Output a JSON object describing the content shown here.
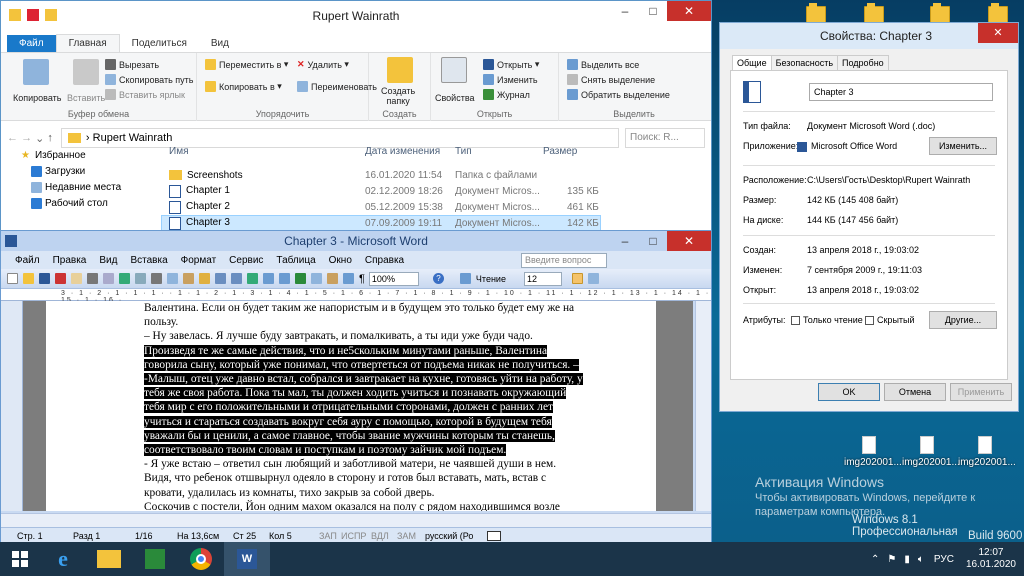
{
  "desktop": {
    "icons": [
      {
        "label": "img202001..."
      },
      {
        "label": "img202001..."
      },
      {
        "label": "img202001..."
      }
    ],
    "activation": {
      "title": "Активация Windows",
      "line1": "Чтобы активировать Windows, перейдите к",
      "line2": "параметрам компьютера.",
      "edition": "Windows 8.1 Профессиональная",
      "build": "Build 9600"
    }
  },
  "explorer": {
    "title": "Rupert Wainrath",
    "tabs": [
      "Файл",
      "Главная",
      "Поделиться",
      "Вид"
    ],
    "ribbon": {
      "copy": "Копировать",
      "paste": "Вставить",
      "cut": "Вырезать",
      "copy_path": "Скопировать путь",
      "paste_shortcut": "Вставить ярлык",
      "clipboard": "Буфер обмена",
      "move_to": "Переместить в",
      "copy_to": "Копировать в",
      "delete": "Удалить",
      "rename": "Переименовать",
      "organize": "Упорядочить",
      "new_folder_1": "Создать",
      "new_folder_2": "папку",
      "create": "Создать",
      "properties": "Свойства",
      "open": "Открыть",
      "edit": "Изменить",
      "history": "Журнал",
      "open_group": "Открыть",
      "select_all": "Выделить все",
      "select_none": "Снять выделение",
      "invert": "Обратить выделение",
      "select": "Выделить"
    },
    "address": "Rupert Wainrath",
    "search_placeholder": "Поиск: R...",
    "nav": [
      "Избранное",
      "Загрузки",
      "Недавние места",
      "Рабочий стол"
    ],
    "columns": [
      "Имя",
      "Дата изменения",
      "Тип",
      "Размер"
    ],
    "rows": [
      {
        "name": "Screenshots",
        "date": "16.01.2020 11:54",
        "type": "Папка с файлами",
        "size": ""
      },
      {
        "name": "Chapter 1",
        "date": "02.12.2009 18:26",
        "type": "Документ Micros...",
        "size": "135 КБ"
      },
      {
        "name": "Chapter 2",
        "date": "05.12.2009 15:38",
        "type": "Документ Micros...",
        "size": "461 КБ"
      },
      {
        "name": "Chapter 3",
        "date": "07.09.2009 19:11",
        "type": "Документ Micros...",
        "size": "142 КБ"
      }
    ]
  },
  "word": {
    "title": "Chapter 3 - Microsoft Word",
    "menu": [
      "Файл",
      "Правка",
      "Вид",
      "Вставка",
      "Формат",
      "Сервис",
      "Таблица",
      "Окно",
      "Справка"
    ],
    "help_placeholder": "Введите вопрос",
    "zoom": "100%",
    "reading": "Чтение",
    "font_size": "12",
    "lines": [
      {
        "text": "Валентина. Если он  будет таким же напористым и в будущем это  только будет ему же на",
        "hl": false
      },
      {
        "text": "пользу.",
        "hl": false
      },
      {
        "text": "– Ну завелась. Я лучше буду завтракать, и помалкивать, а ты иди уже буди чадо.",
        "hl": false
      },
      {
        "text": "   Произведя те же самые действия, что и не5скольким минутами раньше, Валентина",
        "hl": true
      },
      {
        "text": "говорила сыну, который уже понимал, что отвертеться от подъема никак  не получиться. –",
        "hl": true
      },
      {
        "text": "-Малыш, отец уже давно встал, собрался и завтракает на кухне, готовясь уйти на работу, у",
        "hl": true
      },
      {
        "text": "тебя же своя работа. Пока ты мал, ты должен ходить учиться и познавать окружающий",
        "hl": true
      },
      {
        "text": "тебя мир с его положительными и отрицательными сторонами, должен с ранних лет",
        "hl": true
      },
      {
        "text": "учиться и стараться создавать вокруг себя ауру с помощью, которой в будущем тебя",
        "hl": true
      },
      {
        "text": "уважали бы и ценили, а самое главное, чтобы  звание  мужчины  которым ты станешь,",
        "hl": true
      },
      {
        "text": "соответствовало твоим словам и поступкам и поэтому зайчик мой подъем.",
        "hl": true
      },
      {
        "text": "- Я уже  встаю – ответил сын любящий и заботливой матери, не чаявшей души в нем.",
        "hl": false
      },
      {
        "text": "Видя, что ребенок отшвырнул одеяло в сторону и  готов был вставать, мать, встав с",
        "hl": false
      },
      {
        "text": "кровати, удалилась из комнаты, тихо закрыв за собой дверь.",
        "hl": false
      },
      {
        "text": "Соскочив с постели, Йон одним махом  оказался на полу с рядом находившимся возле",
        "hl": false
      }
    ],
    "status": {
      "page": "Стр. 1",
      "section": "Разд 1",
      "pages": "1/16",
      "at": "На 13,6см",
      "line": "Ст  25",
      "col": "Кол  5",
      "rec": "ЗАП",
      "trk": "ИСПР",
      "ext": "ВДЛ",
      "ovr": "ЗАМ",
      "lang": "русский (Ро"
    }
  },
  "props": {
    "title": "Свойства: Chapter 3",
    "tabs": [
      "Общие",
      "Безопасность",
      "Подробно"
    ],
    "filename": "Chapter 3",
    "labels": {
      "type": "Тип файла:",
      "app": "Приложение:",
      "location": "Расположение:",
      "size": "Размер:",
      "disk": "На диске:",
      "created": "Создан:",
      "modified": "Изменен:",
      "opened": "Открыт:",
      "attrs": "Атрибуты:"
    },
    "values": {
      "type": "Документ Microsoft Word (.doc)",
      "app": "Microsoft Office Word",
      "location": "C:\\Users\\Гость\\Desktop\\Rupert Wainrath",
      "size": "142 КБ (145 408 байт)",
      "disk": "144 КБ (147 456 байт)",
      "created": "13 апреля 2018 г., 19:03:02",
      "modified": "7 сентября 2009 г., 19:11:03",
      "opened": "13 апреля 2018 г., 19:03:02"
    },
    "change": "Изменить...",
    "readonly": "Только чтение",
    "hidden": "Скрытый",
    "other": "Другие...",
    "ok": "OK",
    "cancel": "Отмена",
    "apply": "Применить"
  },
  "taskbar": {
    "lang": "РУС",
    "time": "12:07",
    "date": "16.01.2020"
  }
}
